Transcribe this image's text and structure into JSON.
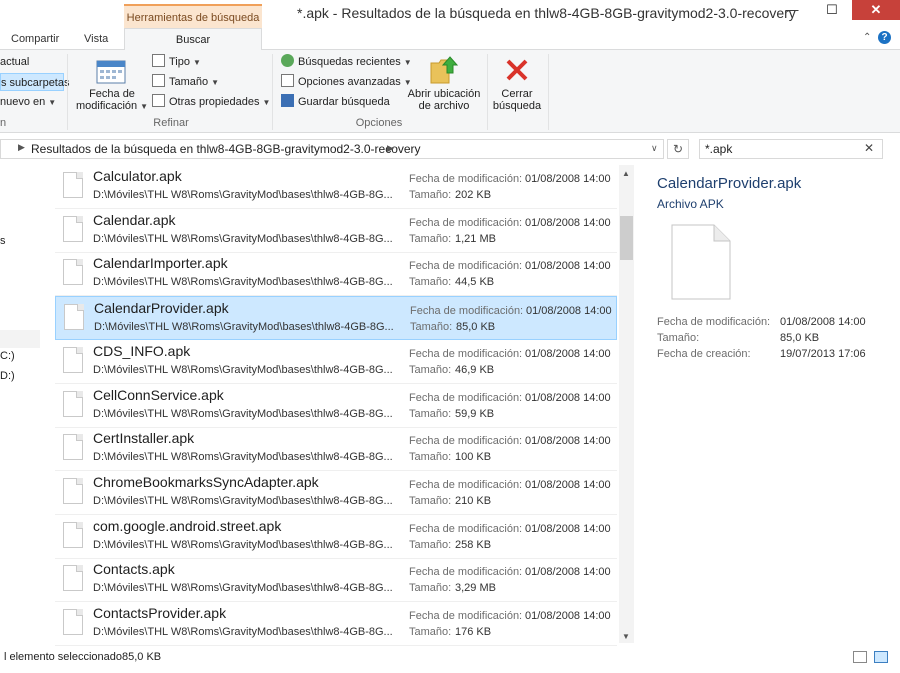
{
  "window": {
    "title": "*.apk - Resultados de la búsqueda en thlw8-4GB-8GB-gravitymod2-3.0-recovery",
    "context_tab": "Herramientas de búsqueda",
    "minimize": "—",
    "maximize": "☐",
    "close": "✕"
  },
  "ribbon_tabs": {
    "compartir": "Compartir",
    "vista": "Vista",
    "buscar": "Buscar"
  },
  "ribbon": {
    "ubicacion_items": [
      "actual",
      "s subcarpetas",
      "nuevo en"
    ],
    "ubicacion_label": "n",
    "fecha_label_line1": "Fecha de",
    "fecha_label_line2": "modificación",
    "tipo": "Tipo",
    "tamano": "Tamaño",
    "otras_propiedades": "Otras propiedades",
    "refinar_label": "Refinar",
    "busquedas_recientes": "Búsquedas recientes",
    "opciones_avanzadas": "Opciones avanzadas",
    "guardar_busqueda": "Guardar búsqueda",
    "opciones_label": "Opciones",
    "abrir_ubicacion_line1": "Abrir ubicación",
    "abrir_ubicacion_line2": "de archivo",
    "cerrar_busqueda_line1": "Cerrar",
    "cerrar_busqueda_line2": "búsqueda"
  },
  "address": {
    "breadcrumb": "Resultados de la búsqueda en thlw8-4GB-8GB-gravitymod2-3.0-recovery",
    "search_value": "*.apk"
  },
  "nav": {
    "items": [
      "s",
      "C:)",
      "D:)"
    ]
  },
  "meta_labels": {
    "modified": "Fecha de modificación:",
    "size": "Tamaño:"
  },
  "files": [
    {
      "name": "Calculator.apk",
      "path": "D:\\Móviles\\THL W8\\Roms\\GravityMod\\bases\\thlw8-4GB-8G...",
      "date": "01/08/2008 14:00",
      "size": "202 KB"
    },
    {
      "name": "Calendar.apk",
      "path": "D:\\Móviles\\THL W8\\Roms\\GravityMod\\bases\\thlw8-4GB-8G...",
      "date": "01/08/2008 14:00",
      "size": "1,21 MB"
    },
    {
      "name": "CalendarImporter.apk",
      "path": "D:\\Móviles\\THL W8\\Roms\\GravityMod\\bases\\thlw8-4GB-8G...",
      "date": "01/08/2008 14:00",
      "size": "44,5 KB"
    },
    {
      "name": "CalendarProvider.apk",
      "path": "D:\\Móviles\\THL W8\\Roms\\GravityMod\\bases\\thlw8-4GB-8G...",
      "date": "01/08/2008 14:00",
      "size": "85,0 KB"
    },
    {
      "name": "CDS_INFO.apk",
      "path": "D:\\Móviles\\THL W8\\Roms\\GravityMod\\bases\\thlw8-4GB-8G...",
      "date": "01/08/2008 14:00",
      "size": "46,9 KB"
    },
    {
      "name": "CellConnService.apk",
      "path": "D:\\Móviles\\THL W8\\Roms\\GravityMod\\bases\\thlw8-4GB-8G...",
      "date": "01/08/2008 14:00",
      "size": "59,9 KB"
    },
    {
      "name": "CertInstaller.apk",
      "path": "D:\\Móviles\\THL W8\\Roms\\GravityMod\\bases\\thlw8-4GB-8G...",
      "date": "01/08/2008 14:00",
      "size": "100 KB"
    },
    {
      "name": "ChromeBookmarksSyncAdapter.apk",
      "path": "D:\\Móviles\\THL W8\\Roms\\GravityMod\\bases\\thlw8-4GB-8G...",
      "date": "01/08/2008 14:00",
      "size": "210 KB"
    },
    {
      "name": "com.google.android.street.apk",
      "path": "D:\\Móviles\\THL W8\\Roms\\GravityMod\\bases\\thlw8-4GB-8G...",
      "date": "01/08/2008 14:00",
      "size": "258 KB"
    },
    {
      "name": "Contacts.apk",
      "path": "D:\\Móviles\\THL W8\\Roms\\GravityMod\\bases\\thlw8-4GB-8G...",
      "date": "01/08/2008 14:00",
      "size": "3,29 MB"
    },
    {
      "name": "ContactsProvider.apk",
      "path": "D:\\Móviles\\THL W8\\Roms\\GravityMod\\bases\\thlw8-4GB-8G...",
      "date": "01/08/2008 14:00",
      "size": "176 KB"
    }
  ],
  "details": {
    "name": "CalendarProvider.apk",
    "type": "Archivo APK",
    "modified_label": "Fecha de modificación:",
    "modified_value": "01/08/2008 14:00",
    "size_label": "Tamaño:",
    "size_value": "85,0 KB",
    "created_label": "Fecha de creación:",
    "created_value": "19/07/2013 17:06"
  },
  "status": {
    "selected": "l elemento seleccionado",
    "size": "85,0 KB"
  },
  "colors": {
    "accent": "#0078d7",
    "selection": "#cde8ff",
    "context_tab": "#fbe5cf",
    "close": "#c7413a"
  }
}
